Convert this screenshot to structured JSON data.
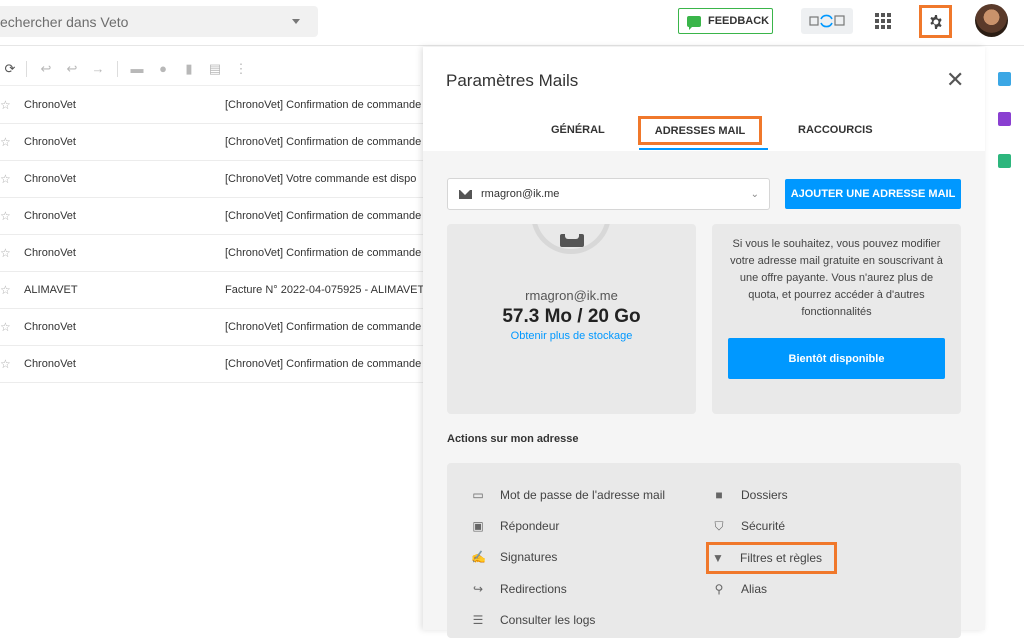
{
  "topbar": {
    "search_placeholder": "echercher dans Veto",
    "feedback_label": "FEEDBACK"
  },
  "mail_list": {
    "rows": [
      {
        "sender": "ChronoVet",
        "subject": "[ChronoVet] Confirmation de commande"
      },
      {
        "sender": "ChronoVet",
        "subject": "[ChronoVet] Confirmation de commande"
      },
      {
        "sender": "ChronoVet",
        "subject": "[ChronoVet] Votre commande est dispo"
      },
      {
        "sender": "ChronoVet",
        "subject": "[ChronoVet] Confirmation de commande"
      },
      {
        "sender": "ChronoVet",
        "subject": "[ChronoVet] Confirmation de commande"
      },
      {
        "sender": "ALIMAVET",
        "subject": "Facture N° 2022-04-075925 - ALIMAVET"
      },
      {
        "sender": "ChronoVet",
        "subject": "[ChronoVet] Confirmation de commande"
      },
      {
        "sender": "ChronoVet",
        "subject": "[ChronoVet] Confirmation de commande"
      }
    ]
  },
  "settings": {
    "title": "Paramètres Mails",
    "tabs": {
      "general": "GÉNÉRAL",
      "adresses": "ADRESSES MAIL",
      "raccourcis": "RACCOURCIS"
    },
    "selected_address": "rmagron@ik.me",
    "add_address_label": "AJOUTER UNE ADRESSE MAIL",
    "storage": {
      "email": "rmagron@ik.me",
      "usage": "57.3 Mo / 20 Go",
      "more_link": "Obtenir plus de stockage"
    },
    "promo": {
      "text": "Si vous le souhaitez, vous pouvez modifier votre adresse mail gratuite en souscrivant à une offre payante. Vous n'aurez plus de quota, et pourrez accéder à d'autres fonctionnalités",
      "button": "Bientôt disponible"
    },
    "actions_title": "Actions sur mon adresse",
    "actions": {
      "password": "Mot de passe de l'adresse mail",
      "repondeur": "Répondeur",
      "signatures": "Signatures",
      "redirections": "Redirections",
      "logs": "Consulter les logs",
      "dossiers": "Dossiers",
      "securite": "Sécurité",
      "filtres": "Filtres et règles",
      "alias": "Alias"
    }
  },
  "colors": {
    "accent_blue": "#0098ff",
    "highlight_orange": "#f0782b",
    "feedback_green": "#3ab54a"
  }
}
